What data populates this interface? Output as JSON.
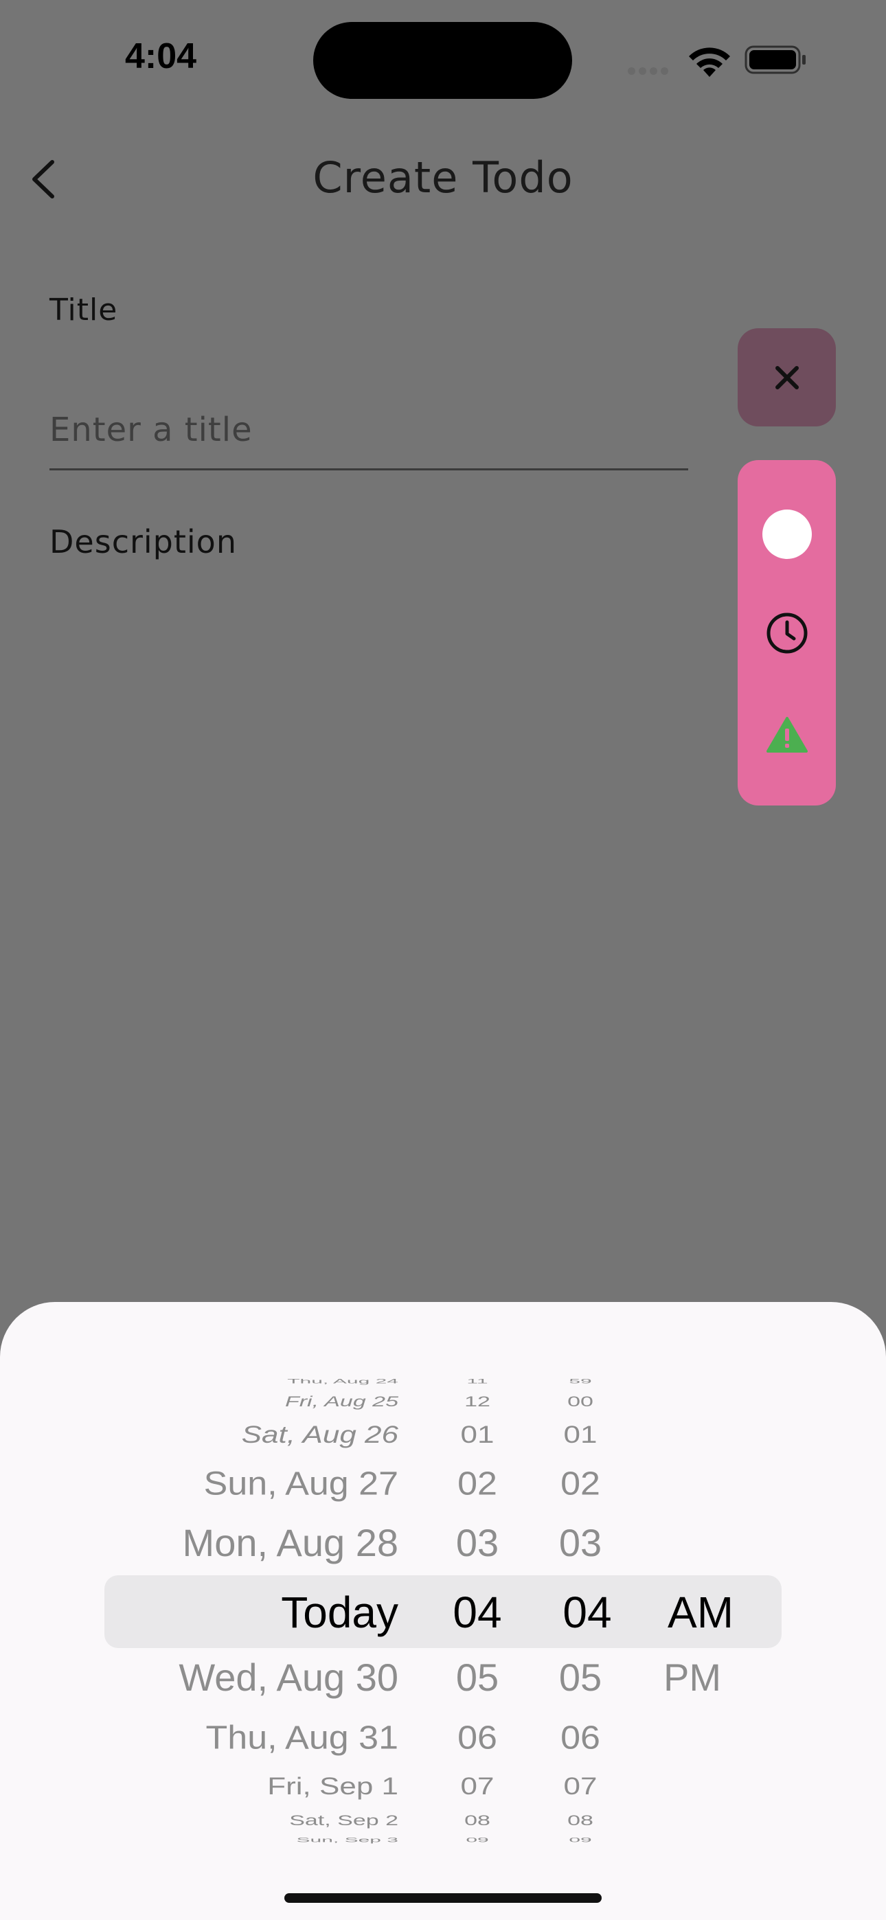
{
  "status_bar": {
    "time": "4:04"
  },
  "header": {
    "title": "Create Todo"
  },
  "form": {
    "title_label": "Title",
    "title_placeholder": "Enter a title",
    "title_value": "",
    "description_label": "Description"
  },
  "tools": {
    "colors": {
      "close_bg": "#6f4d5d",
      "panel_bg": "#e46c9f",
      "warning": "#4caf50"
    }
  },
  "picker": {
    "dates": [
      "Thu, Aug 24",
      "Fri, Aug 25",
      "Sat, Aug 26",
      "Sun, Aug 27",
      "Mon, Aug 28",
      "Today",
      "Wed, Aug 30",
      "Thu, Aug 31",
      "Fri, Sep 1",
      "Sat, Sep 2",
      "Sun, Sep 3"
    ],
    "hours": [
      "11",
      "12",
      "01",
      "02",
      "03",
      "04",
      "05",
      "06",
      "07",
      "08",
      "09"
    ],
    "minutes": [
      "59",
      "00",
      "01",
      "02",
      "03",
      "04",
      "05",
      "06",
      "07",
      "08",
      "09"
    ],
    "ampm": [
      "AM",
      "PM"
    ],
    "selected": {
      "date": "Today",
      "hour": "04",
      "minute": "04",
      "period": "AM"
    }
  }
}
